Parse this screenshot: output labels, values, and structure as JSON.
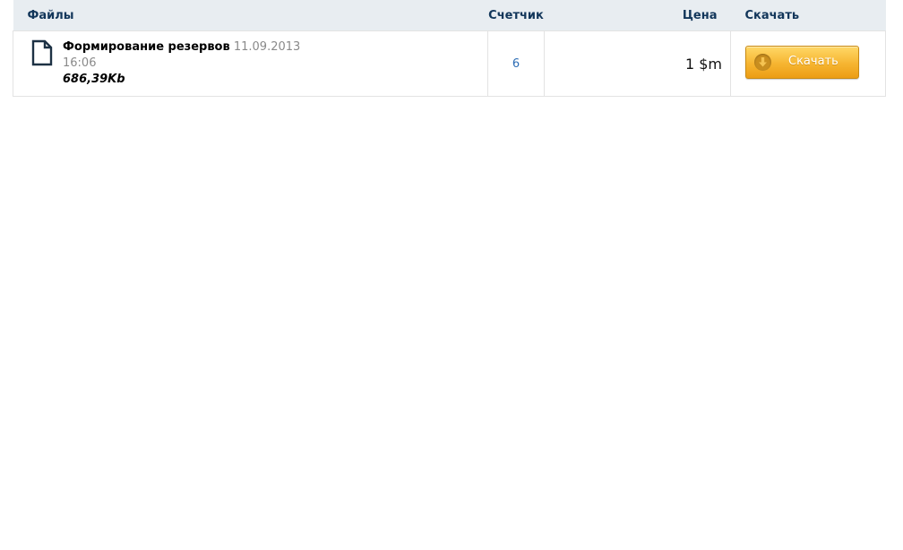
{
  "table": {
    "headers": {
      "files": "Файлы",
      "counter": "Счетчик",
      "price": "Цена",
      "download": "Скачать"
    },
    "rows": [
      {
        "name": "Формирование резервов",
        "date": "11.09.2013",
        "time": "16:06",
        "size": "686,39Kb",
        "counter": "6",
        "price": "1 $m",
        "download_label": "Скачать"
      }
    ]
  },
  "icons": {
    "file": "document-icon",
    "download": "download-arrow-icon"
  },
  "colors": {
    "header_bg": "#e8edf1",
    "header_text": "#12365a",
    "counter_link": "#2d6db5",
    "button_orange": "#f6b531"
  }
}
